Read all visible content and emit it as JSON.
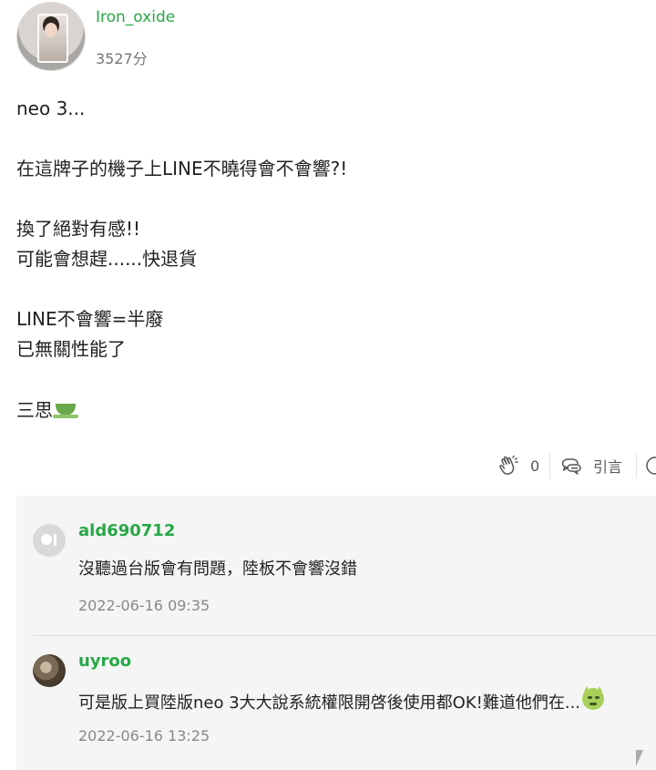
{
  "post": {
    "author": "Iron_oxide",
    "points": "3527分",
    "lines": {
      "l1": "neo 3...",
      "l2": "在這牌子的機子上LINE不曉得會不會響?!",
      "l3": "換了絕對有感!!",
      "l4": "可能會想趕......快退貨",
      "l5": "LINE不會響=半廢",
      "l6": "已無關性能了",
      "l7": "三思"
    },
    "emoji_icon": "tea-cup-icon"
  },
  "actions": {
    "clap_count": "0",
    "quote_label": "引言"
  },
  "comments": [
    {
      "author": "ald690712",
      "text": "沒聽過台版會有問題，陸板不會響沒錯",
      "time": "2022-06-16 09:35"
    },
    {
      "author": "uyroo",
      "text": "可是版上買陸版neo 3大大說系統權限開啓後使用都OK!難道他們在...",
      "time": "2022-06-16 13:25",
      "emoji_icon": "sick-face-icon"
    }
  ],
  "colors": {
    "accent_green": "#27a847",
    "comment_bg": "#f5f5f5",
    "muted_text": "#888888"
  }
}
